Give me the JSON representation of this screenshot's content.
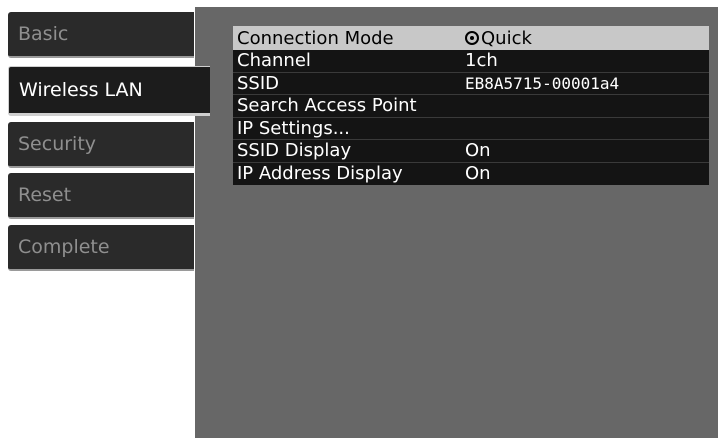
{
  "sidebar": {
    "items": [
      {
        "label": "Basic"
      },
      {
        "label": "Wireless LAN"
      },
      {
        "label": "Security"
      },
      {
        "label": "Reset"
      },
      {
        "label": "Complete"
      }
    ],
    "active_item": "Wireless LAN"
  },
  "menu": {
    "rows": [
      {
        "label": "Connection Mode",
        "value": "Quick"
      },
      {
        "label": "Channel",
        "value": "1ch"
      },
      {
        "label": "SSID",
        "value": "EB8A5715-00001a4"
      },
      {
        "label": "Search Access Point",
        "value": ""
      },
      {
        "label": "IP Settings...",
        "value": ""
      },
      {
        "label": "SSID Display",
        "value": "On"
      },
      {
        "label": "IP Address Display",
        "value": "On"
      }
    ]
  },
  "colors": {
    "panel_background": "#676767",
    "selected_row": "#c8c8c8",
    "tab_background": "#2a2a2a"
  },
  "icons": {
    "connection_mode": "selected-radio-icon"
  }
}
